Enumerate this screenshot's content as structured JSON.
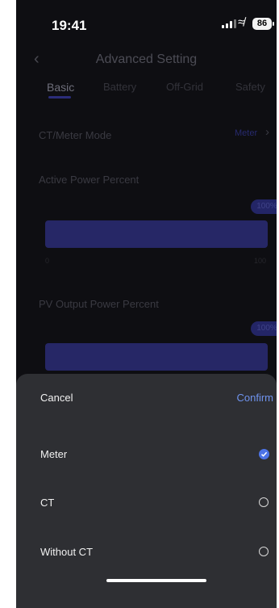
{
  "status_bar": {
    "time": "19:41",
    "battery": "86"
  },
  "header": {
    "title": "Advanced Setting"
  },
  "tabs": [
    {
      "label": "Basic",
      "active": true
    },
    {
      "label": "Battery",
      "active": false
    },
    {
      "label": "Off-Grid",
      "active": false
    },
    {
      "label": "Safety",
      "active": false
    }
  ],
  "ct_meter": {
    "label": "CT/Meter Mode",
    "value": "Meter"
  },
  "active_power": {
    "label": "Active Power Percent",
    "value_label": "100%",
    "percent": 100,
    "min": "0",
    "max": "100"
  },
  "pv_output": {
    "label": "PV Output Power Percent",
    "value_label": "100%",
    "percent": 100
  },
  "sheet": {
    "cancel": "Cancel",
    "confirm": "Confirm",
    "options": [
      {
        "label": "Meter",
        "selected": true
      },
      {
        "label": "CT",
        "selected": false
      },
      {
        "label": "Without CT",
        "selected": false
      }
    ]
  },
  "colors": {
    "accent": "#4c73e6",
    "confirm": "#6f93ee",
    "sheet_bg": "#2e2f33",
    "slider": "#262766"
  }
}
